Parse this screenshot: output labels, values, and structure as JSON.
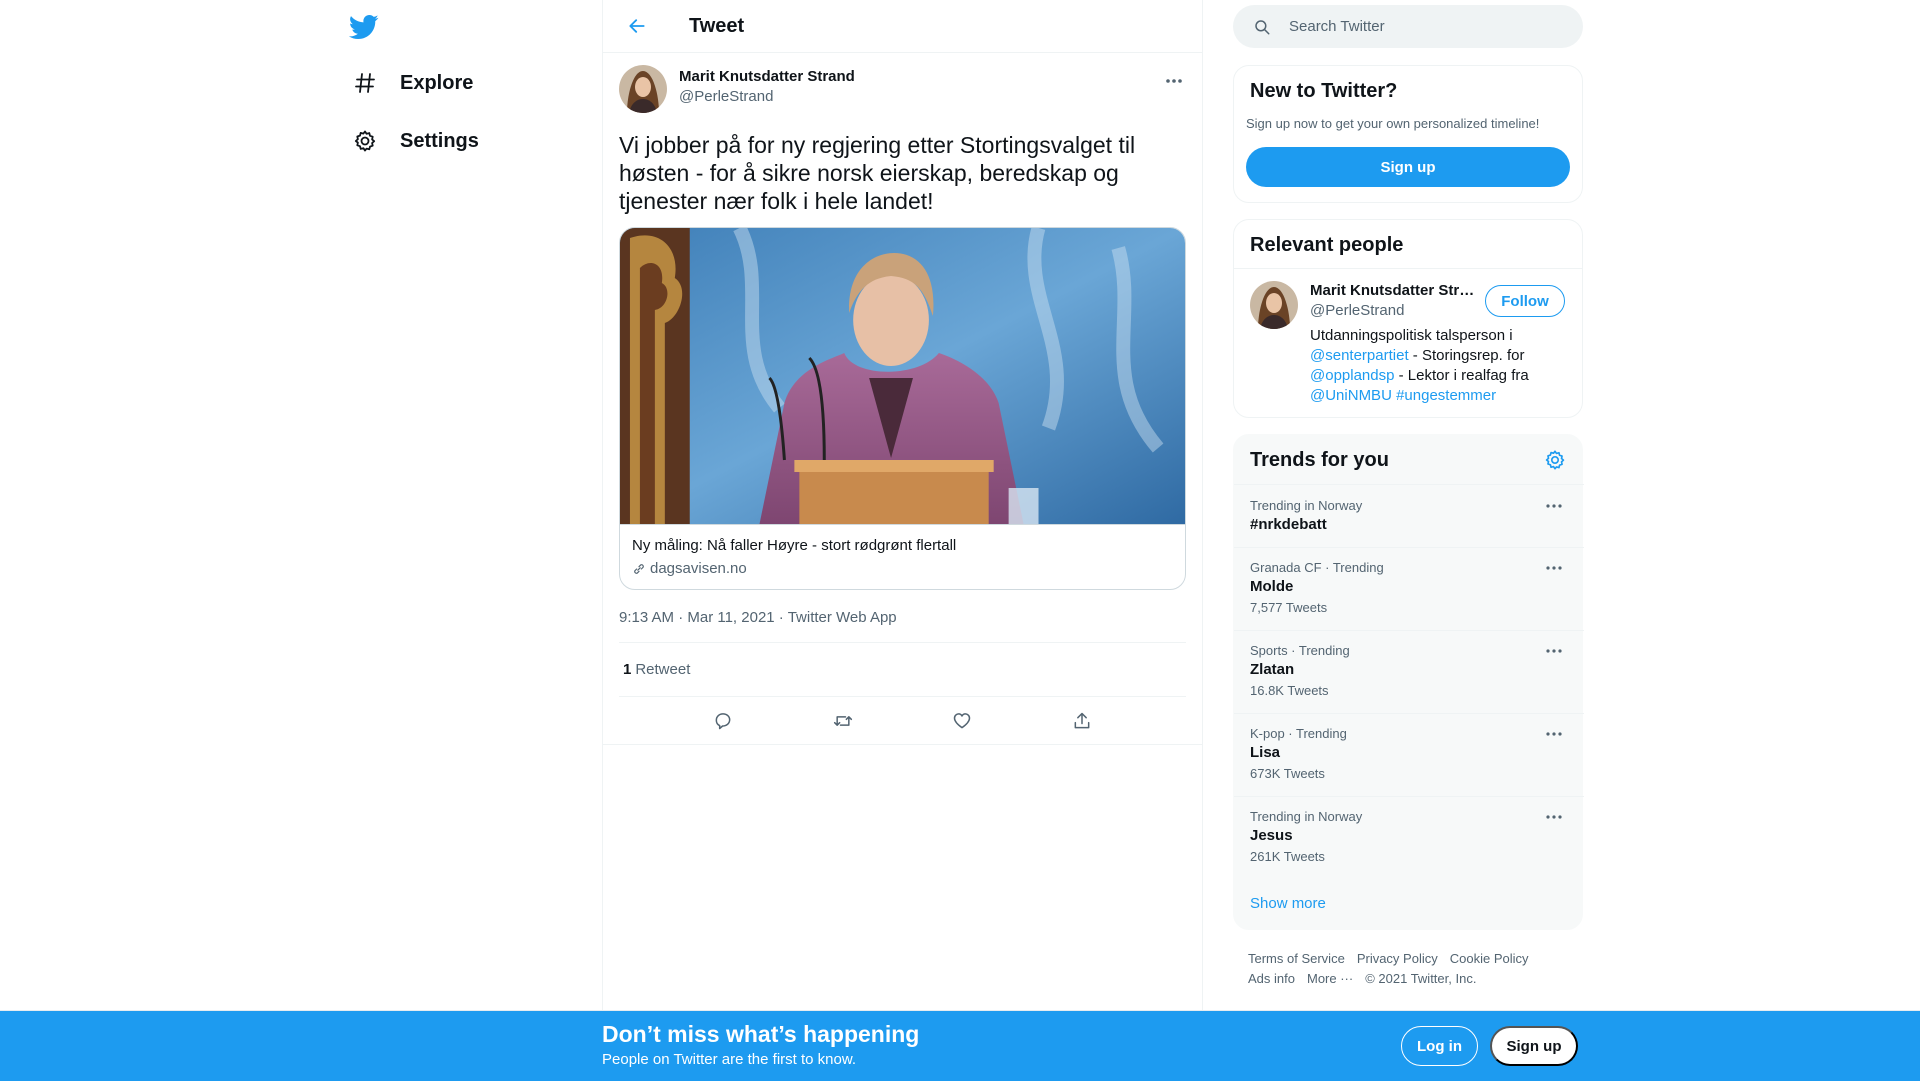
{
  "nav": {
    "logo_icon": "twitter-bird-icon",
    "items": [
      {
        "label": "Explore",
        "icon": "hashtag-icon"
      },
      {
        "label": "Settings",
        "icon": "gear-icon"
      }
    ]
  },
  "main": {
    "title": "Tweet",
    "tweet": {
      "author_name": "Marit Knutsdatter Strand",
      "author_handle": "@PerleStrand",
      "text": "Vi jobber på for ny regjering etter Stortingsvalget til høsten - for å sikre norsk eierskap, beredskap og tjenester nær folk i hele landet!",
      "card": {
        "title": "Ny måling: Nå faller Høyre - stort rødgrønt flertall",
        "domain": "dagsavisen.no"
      },
      "meta": "9:13 AM · Mar 11, 2021 · Twitter Web App",
      "retweet_count": "1",
      "retweet_label": "Retweet"
    }
  },
  "search": {
    "placeholder": "Search Twitter"
  },
  "new_to_twitter": {
    "title": "New to Twitter?",
    "subtitle": "Sign up now to get your own personalized timeline!",
    "signup_label": "Sign up"
  },
  "relevant_people": {
    "title": "Relevant people",
    "name": "Marit Knutsdatter Strand",
    "handle": "@PerleStrand",
    "follow_label": "Follow",
    "bio": {
      "part1": "Utdanningspolitisk talsperson i ",
      "link1": "@senterpartiet",
      "part2": " - Storingsrep. for ",
      "link2": "@opplandsp",
      "part3": " - Lektor i realfag fra ",
      "link3": "@UniNMBU",
      "part4": " ",
      "link4": "#ungestemmer"
    }
  },
  "trends": {
    "title": "Trends for you",
    "items": [
      {
        "category": "Trending in Norway",
        "name": "#nrkdebatt",
        "count": ""
      },
      {
        "category": "Granada CF · Trending",
        "name": "Molde",
        "count": "7,577 Tweets"
      },
      {
        "category": "Sports · Trending",
        "name": "Zlatan",
        "count": "16.8K Tweets"
      },
      {
        "category": "K-pop · Trending",
        "name": "Lisa",
        "count": "673K Tweets"
      },
      {
        "category": "Trending in Norway",
        "name": "Jesus",
        "count": "261K Tweets"
      }
    ],
    "show_more": "Show more"
  },
  "footer": {
    "terms": "Terms of Service",
    "privacy": "Privacy Policy",
    "cookie": "Cookie Policy",
    "ads": "Ads info",
    "more": "More ···",
    "copyright": "© 2021 Twitter, Inc."
  },
  "bottom_bar": {
    "title": "Don’t miss what’s happening",
    "subtitle": "People on Twitter are the first to know.",
    "login_label": "Log in",
    "signup_label": "Sign up"
  },
  "colors": {
    "accent": "#1d9bf0",
    "text": "#0f1419",
    "secondary": "#536471"
  }
}
